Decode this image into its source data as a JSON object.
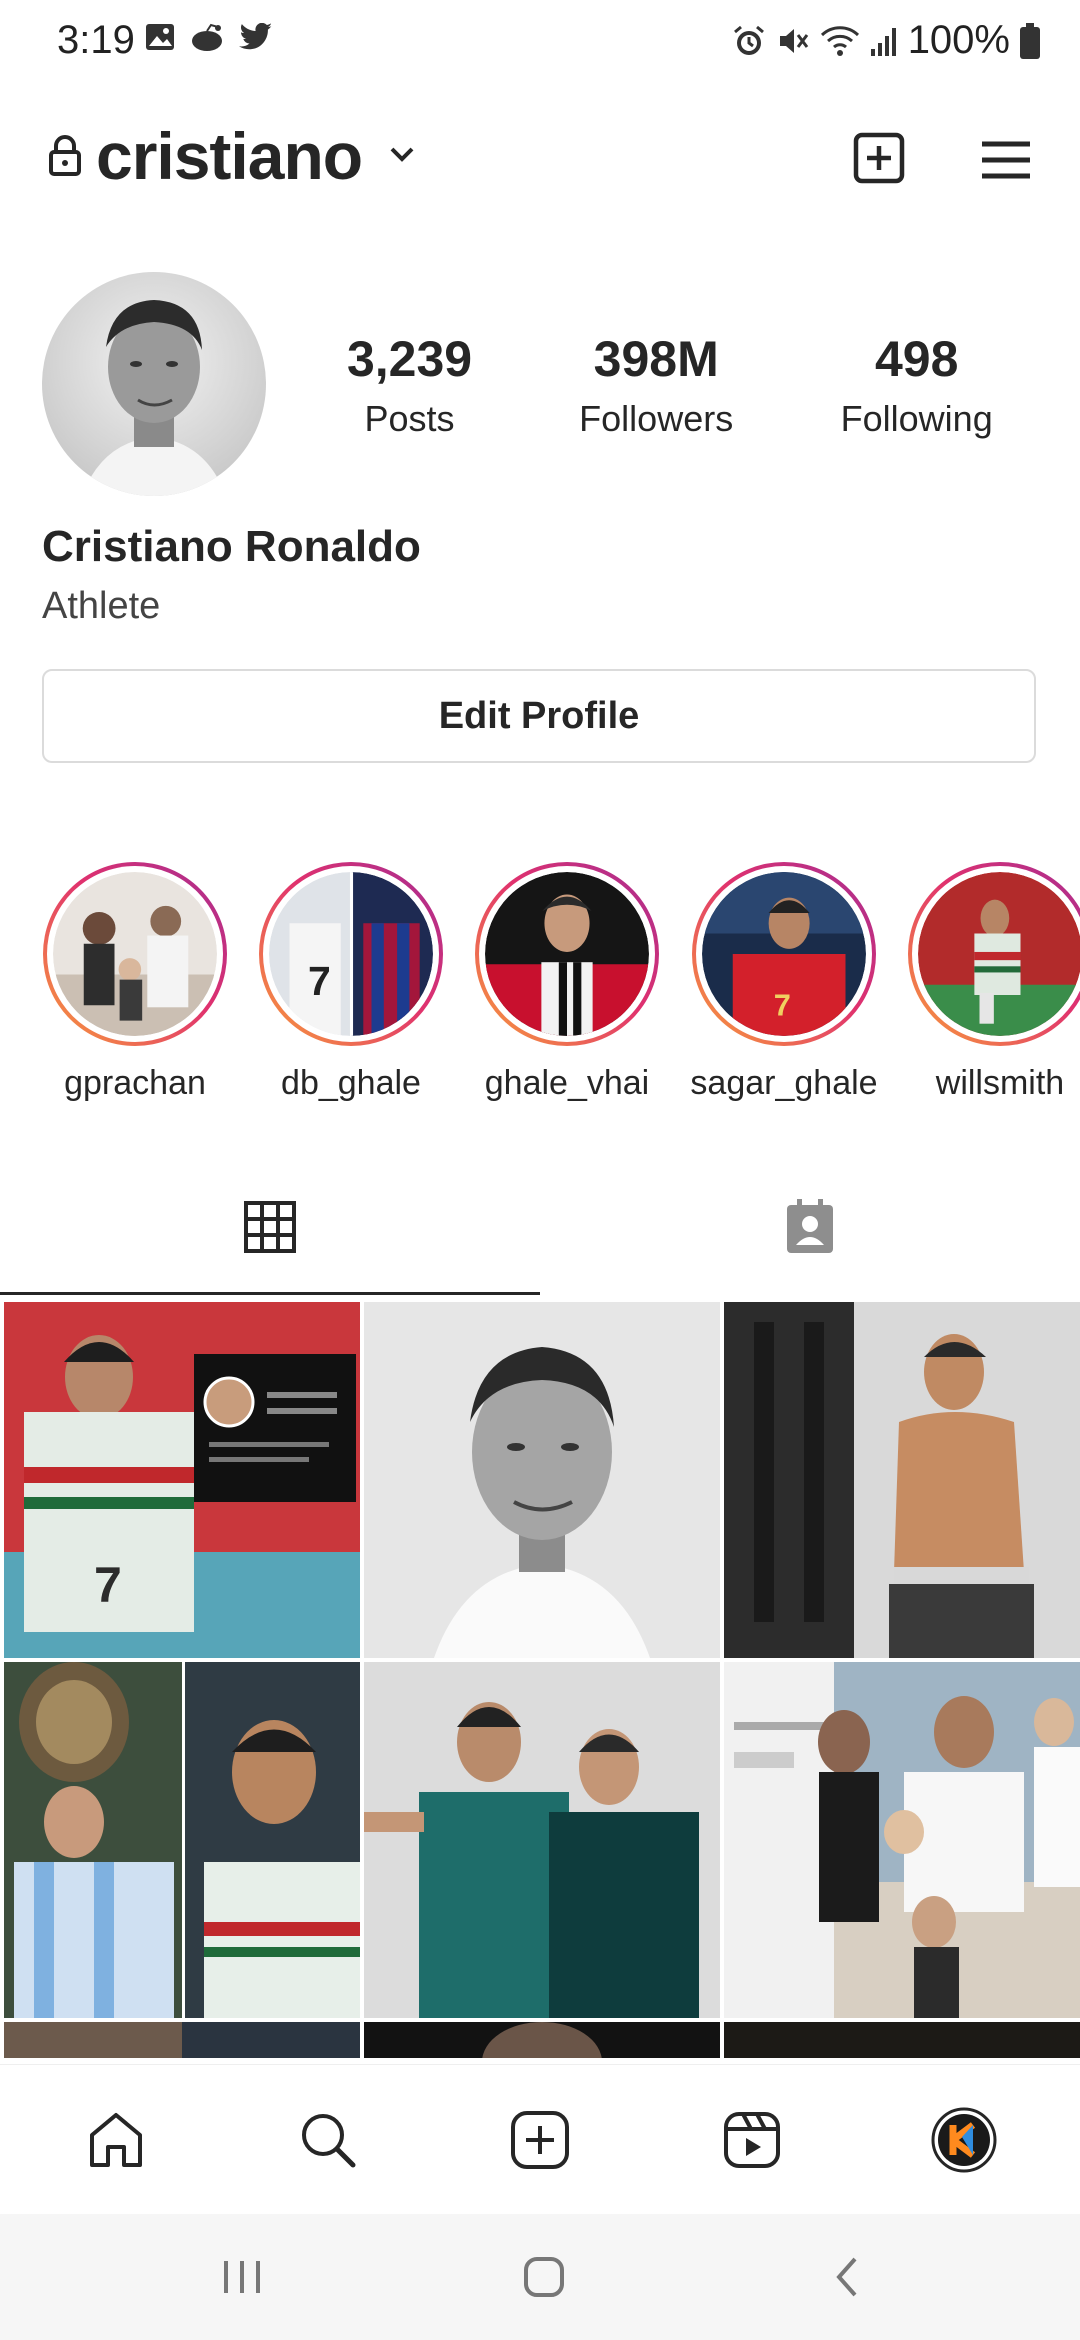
{
  "status_bar": {
    "time": "3:19",
    "battery_percent": "100%",
    "left_icons": [
      "gallery-icon",
      "reddit-icon",
      "twitter-icon"
    ],
    "right_icons": [
      "alarm-icon",
      "mute-icon",
      "wifi-icon",
      "signal-icon",
      "battery-icon"
    ]
  },
  "header": {
    "username": "cristiano",
    "icons": [
      "lock-icon",
      "chevron-down-icon",
      "new-post-icon",
      "menu-icon"
    ]
  },
  "profile": {
    "stats": [
      {
        "value": "3,239",
        "label": "Posts"
      },
      {
        "value": "398M",
        "label": "Followers"
      },
      {
        "value": "498",
        "label": "Following"
      }
    ],
    "full_name": "Cristiano Ronaldo",
    "category": "Athlete",
    "edit_profile_label": "Edit Profile"
  },
  "highlights": [
    {
      "name": "gprachan"
    },
    {
      "name": "db_ghale"
    },
    {
      "name": "ghale_vhai"
    },
    {
      "name": "sagar_ghale"
    },
    {
      "name": "willsmith"
    }
  ],
  "tabs": {
    "items": [
      "grid-icon",
      "tagged-icon"
    ],
    "active_index": 0
  },
  "bottom_nav": [
    "home-icon",
    "search-icon",
    "create-icon",
    "reels-icon",
    "profile-avatar-icon"
  ],
  "system_nav": [
    "recents-icon",
    "home-button-icon",
    "back-icon"
  ],
  "colors": {
    "story_ring_start": "#f9a03a",
    "story_ring_end": "#a32d94",
    "text": "#262626"
  }
}
